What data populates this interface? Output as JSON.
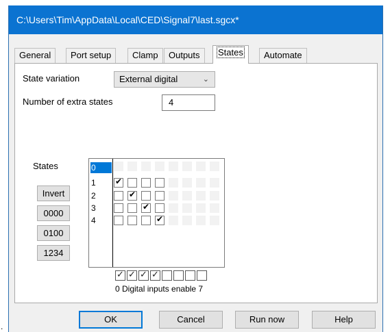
{
  "window": {
    "title": "C:\\Users\\Tim\\AppData\\Local\\CED\\Signal7\\last.sgcx*"
  },
  "tabs": [
    "General",
    "Port setup",
    "Clamp",
    "Outputs",
    "States",
    "Automate"
  ],
  "active_tab": "States",
  "states_tab": {
    "state_variation_label": "State variation",
    "state_variation_value": "External digital",
    "extra_states_label": "Number of extra states",
    "extra_states_value": "4",
    "states_label": "States",
    "buttons": [
      "Invert",
      "0000",
      "0100",
      "1234"
    ],
    "grid": {
      "row_labels": [
        "0",
        "1",
        "2",
        "3",
        "4"
      ],
      "selected_row": "0",
      "rows": [
        [
          0,
          0,
          0,
          0
        ],
        [
          1,
          0,
          0,
          0
        ],
        [
          0,
          1,
          0,
          0
        ],
        [
          0,
          0,
          1,
          0
        ],
        [
          0,
          0,
          0,
          1
        ]
      ]
    },
    "digital_enable": [
      true,
      true,
      true,
      true,
      false,
      false,
      false,
      false
    ],
    "digital_label": "0 Digital inputs enable 7"
  },
  "dialog_buttons": {
    "ok": "OK",
    "cancel": "Cancel",
    "run_now": "Run now",
    "help": "Help"
  },
  "colors": {
    "title_bar": "#0b73d1",
    "selection": "#0078d7",
    "dialog_bg": "#f0f0f0"
  },
  "stray_mark": "."
}
